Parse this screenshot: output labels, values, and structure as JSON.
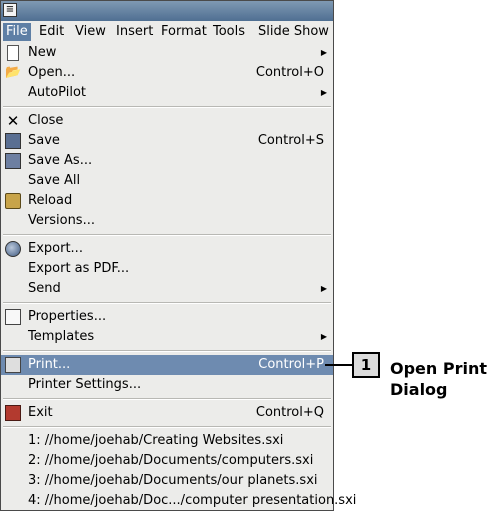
{
  "menubar": {
    "items": [
      "File",
      "Edit",
      "View",
      "Insert",
      "Format",
      "Tools",
      "Slide Show"
    ]
  },
  "file_menu": {
    "new": {
      "label": "New",
      "icon": "new-document-icon"
    },
    "open": {
      "label": "Open...",
      "accel": "Control+O",
      "icon": "open-folder-icon"
    },
    "autopilot": {
      "label": "AutoPilot"
    },
    "close": {
      "label": "Close",
      "icon": "close-x-icon"
    },
    "save": {
      "label": "Save",
      "accel": "Control+S",
      "icon": "save-disk-icon"
    },
    "save_as": {
      "label": "Save As...",
      "icon": "save-as-icon"
    },
    "save_all": {
      "label": "Save All"
    },
    "reload": {
      "label": "Reload",
      "icon": "reload-icon"
    },
    "versions": {
      "label": "Versions..."
    },
    "export": {
      "label": "Export...",
      "icon": "export-icon"
    },
    "export_pdf": {
      "label": "Export as PDF..."
    },
    "send": {
      "label": "Send"
    },
    "properties": {
      "label": "Properties...",
      "icon": "properties-icon"
    },
    "templates": {
      "label": "Templates"
    },
    "print": {
      "label": "Print...",
      "accel": "Control+P",
      "icon": "printer-icon"
    },
    "printer_settings": {
      "label": "Printer Settings..."
    },
    "exit": {
      "label": "Exit",
      "accel": "Control+Q",
      "icon": "exit-icon"
    },
    "recent": [
      "1: //home/joehab/Creating Websites.sxi",
      "2: //home/joehab/Documents/computers.sxi",
      "3: //home/joehab/Documents/our planets.sxi",
      "4: //home/joehab/Doc.../computer presentation.sxi"
    ]
  },
  "callout": {
    "number": "1",
    "text": "Open Print Dialog"
  },
  "colors": {
    "highlight": "#6e8bb0",
    "active_menu": "#5e7fa5",
    "menu_bg": "#ececea"
  }
}
